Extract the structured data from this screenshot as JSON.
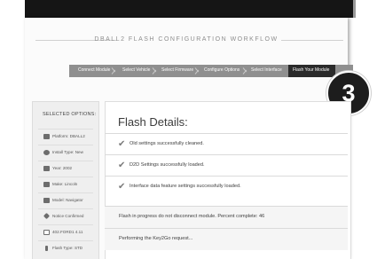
{
  "workflow": {
    "title": "DBALL2 FLASH CONFIGURATION WORKFLOW"
  },
  "steps": [
    {
      "label": "Connect Module"
    },
    {
      "label": "Select Vehicle"
    },
    {
      "label": "Select Firmware"
    },
    {
      "label": "Configure Options"
    },
    {
      "label": "Select Interface"
    },
    {
      "label": "Flash Your Module"
    }
  ],
  "step_badge": "3",
  "sidebar": {
    "heading": "SELECTED OPTIONS:",
    "items": [
      {
        "label": "Platform: DBALL2",
        "icon": "puzzle-icon"
      },
      {
        "label": "Install Type: New",
        "icon": "gear-icon"
      },
      {
        "label": "Year: 2002",
        "icon": "car-icon"
      },
      {
        "label": "Make: Lincoln",
        "icon": "car-icon"
      },
      {
        "label": "Model: Navigator",
        "icon": "car-icon"
      },
      {
        "label": "Notice Confirmed",
        "icon": "diamond-icon"
      },
      {
        "label": "402.FORD1 4.11",
        "icon": "chip-icon"
      },
      {
        "label": "Flash Type: STD",
        "icon": "flash-icon"
      }
    ]
  },
  "flash": {
    "title": "Flash Details:",
    "messages": [
      {
        "text": "Old settings successfully cleaned.",
        "status": "success"
      },
      {
        "text": "D2D Settings successfully loaded.",
        "status": "success"
      },
      {
        "text": "Interface data feature settings successfully loaded.",
        "status": "success"
      },
      {
        "text": "Flash in progress do not disconnect module. Percent complete: 46",
        "status": "info"
      },
      {
        "text": "Performing the Key2Go request...",
        "status": "info"
      }
    ]
  }
}
